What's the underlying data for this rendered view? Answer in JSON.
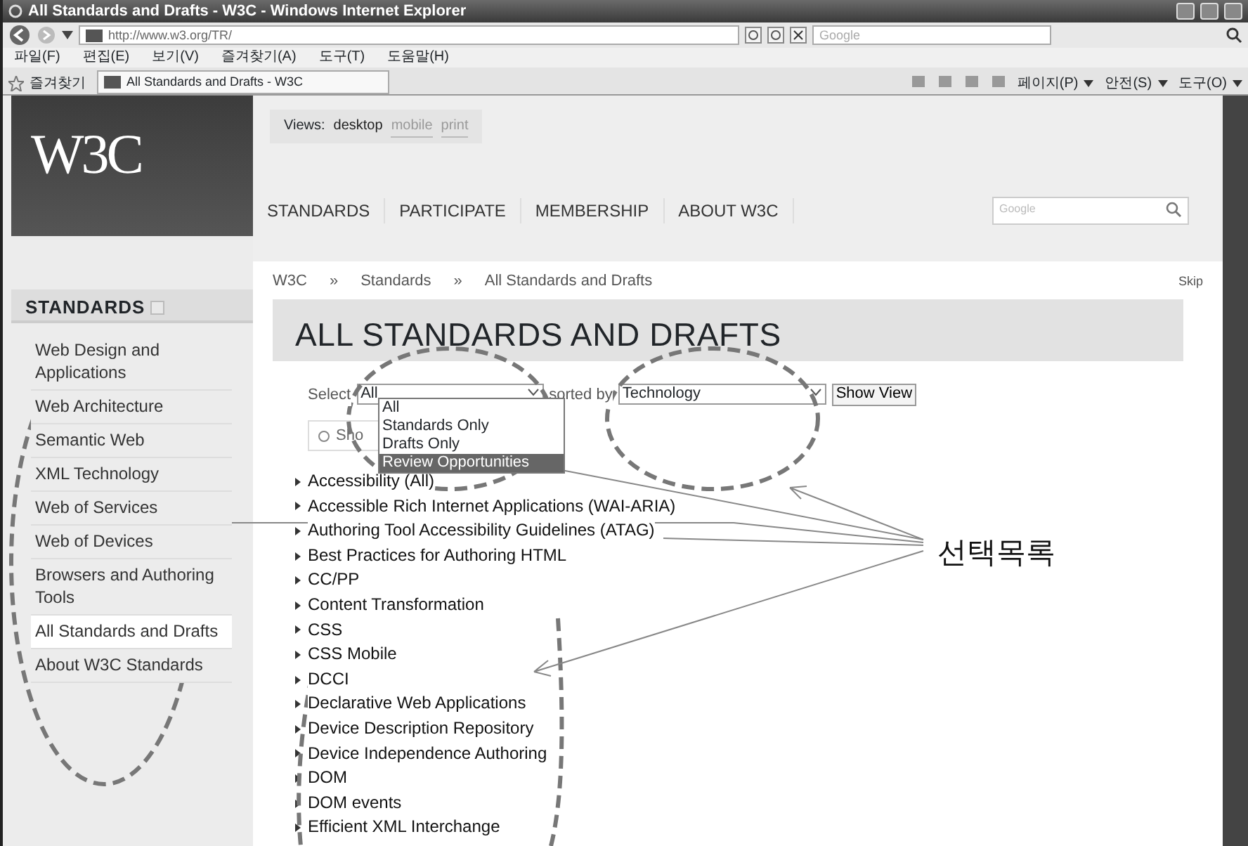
{
  "window": {
    "title": "All Standards and Drafts - W3C - Windows Internet Explorer"
  },
  "address_bar": {
    "url": "http://www.w3.org/TR/",
    "search_placeholder": "Google"
  },
  "menu_bar": [
    "파일(F)",
    "편집(E)",
    "보기(V)",
    "즐겨찾기(A)",
    "도구(T)",
    "도움말(H)"
  ],
  "favorites_bar": {
    "favorites": "즐겨찾기",
    "tab": "All Standards and Drafts - W3C",
    "tools": [
      "페이지(P)",
      "안전(S)",
      "도구(O)"
    ]
  },
  "page": {
    "logo": "W3C",
    "views": {
      "label": "Views:",
      "options": [
        {
          "label": "desktop",
          "selected": true
        },
        {
          "label": "mobile",
          "selected": false
        },
        {
          "label": "print",
          "selected": false
        }
      ]
    },
    "nav": [
      "STANDARDS",
      "PARTICIPATE",
      "MEMBERSHIP",
      "ABOUT W3C"
    ],
    "site_search": {
      "placeholder": "Google"
    },
    "breadcrumb": [
      "W3C",
      "»",
      "Standards",
      "»",
      "All Standards and Drafts"
    ],
    "skip": "Skip",
    "sidebar": {
      "title": "STANDARDS",
      "items": [
        {
          "label": "Web Design and Applications",
          "selected": false
        },
        {
          "label": "Web Architecture",
          "selected": false
        },
        {
          "label": "Semantic Web",
          "selected": false
        },
        {
          "label": "XML Technology",
          "selected": false
        },
        {
          "label": "Web of Services",
          "selected": false
        },
        {
          "label": "Web of Devices",
          "selected": false
        },
        {
          "label": "Browsers and Authoring Tools",
          "selected": false
        },
        {
          "label": "All Standards and Drafts",
          "selected": true
        },
        {
          "label": "About W3C Standards",
          "selected": false
        }
      ]
    },
    "heading": "ALL STANDARDS AND DRAFTS",
    "filter": {
      "select_label": "Select",
      "select_value": "All",
      "sorted_label": "sorted by",
      "sort_value": "Technology",
      "button": "Show View",
      "dropdown": [
        {
          "label": "All",
          "selected": false
        },
        {
          "label": "Standards Only",
          "selected": false
        },
        {
          "label": "Drafts Only",
          "selected": false
        },
        {
          "label": "Review Opportunities",
          "selected": true
        }
      ],
      "search_text": "Sho"
    },
    "technologies": [
      "Accessibility (All)",
      "Accessible Rich Internet Applications (WAI-ARIA)",
      "Authoring Tool Accessibility Guidelines (ATAG)",
      "Best Practices for Authoring HTML",
      "CC/PP",
      "Content Transformation",
      "CSS",
      "CSS Mobile",
      "DCCI",
      "Declarative Web Applications",
      "Device Description Repository",
      "Device Independence Authoring",
      "DOM",
      "DOM events",
      "Efficient XML Interchange"
    ]
  },
  "annotation": {
    "label": "선택목록"
  }
}
